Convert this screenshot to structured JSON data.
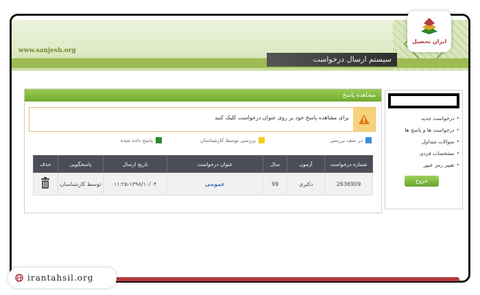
{
  "banner": {
    "url": "www.sanjesh.org",
    "title": "سیستم ارسال درخواست"
  },
  "logo": {
    "name": "ایران تحصیل"
  },
  "sidebar": {
    "items": [
      {
        "label": "درخواست جدید"
      },
      {
        "label": "درخواست ها و پاسخ ها"
      },
      {
        "label": "سوالات متداول"
      },
      {
        "label": "مشخصات فردی"
      },
      {
        "label": "تغییر رمز عبور"
      }
    ],
    "exit_label": "خروج"
  },
  "panel": {
    "title": "مشاهده پاسخ",
    "alert": "برای مشاهده پاسخ خود بر روی عنوان درخواست کلیک کنید"
  },
  "legend": [
    {
      "label": "در صف بررسی",
      "color": "#3c8ad8"
    },
    {
      "label": "بررسی توسط کارشناسان",
      "color": "#f2cf1d"
    },
    {
      "label": "پاسخ داده شده",
      "color": "#2a8a2a"
    }
  ],
  "table": {
    "headers": [
      "شماره درخواست",
      "آزمون",
      "سال",
      "عنوان درخواست",
      "تاریخ ارسال",
      "پاسخگویی",
      "حذف"
    ],
    "rows": [
      {
        "id": "2636909",
        "exam": "دکتری",
        "year": "99",
        "title": "عمومی",
        "date": "۱۱:۲۵-۱۳۹۸/۱۰/۰۴",
        "responder": "توسط کارشناسان"
      }
    ]
  },
  "footer": {
    "site": "irantahsil.org"
  }
}
